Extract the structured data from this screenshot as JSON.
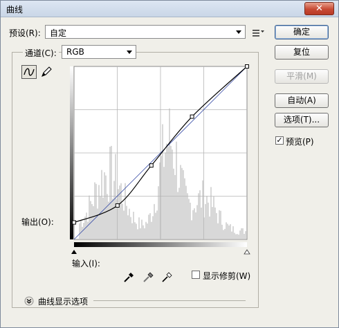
{
  "window": {
    "title": "曲线",
    "close_icon": "close-icon"
  },
  "preset": {
    "label": "预设(R):",
    "value": "自定",
    "menu_icon": "preset-options-icon"
  },
  "channel": {
    "label": "通道(C):",
    "value": "RGB"
  },
  "tools": {
    "curve_tool": "curve-point-icon",
    "pencil_tool": "pencil-icon"
  },
  "buttons": {
    "ok": "确定",
    "reset": "复位",
    "smooth": "平滑(M)",
    "auto": "自动(A)",
    "options": "选项(T)..."
  },
  "preview": {
    "label": "预览(P)",
    "checked": true
  },
  "output_label": "输出(O):",
  "input_label": "输入(I):",
  "eyedroppers": [
    "black-eyedropper-icon",
    "gray-eyedropper-icon",
    "white-eyedropper-icon"
  ],
  "show_clipping": {
    "label": "显示修剪(W)",
    "checked": false
  },
  "curve_display_options": {
    "label": "曲线显示选项",
    "icon": "expand-chevron-icon"
  },
  "curve": {
    "x_range": [
      0,
      255
    ],
    "y_range": [
      0,
      255
    ],
    "points": [
      [
        0,
        25
      ],
      [
        64,
        50
      ],
      [
        114,
        109
      ],
      [
        174,
        181
      ],
      [
        255,
        255
      ]
    ]
  },
  "colors": {
    "window_bg": "#f0efe9",
    "titlebar": "#c9d6e7",
    "histogram": "#c8c8c8",
    "curve": "#000000",
    "baseline": "#3b4fa8"
  }
}
